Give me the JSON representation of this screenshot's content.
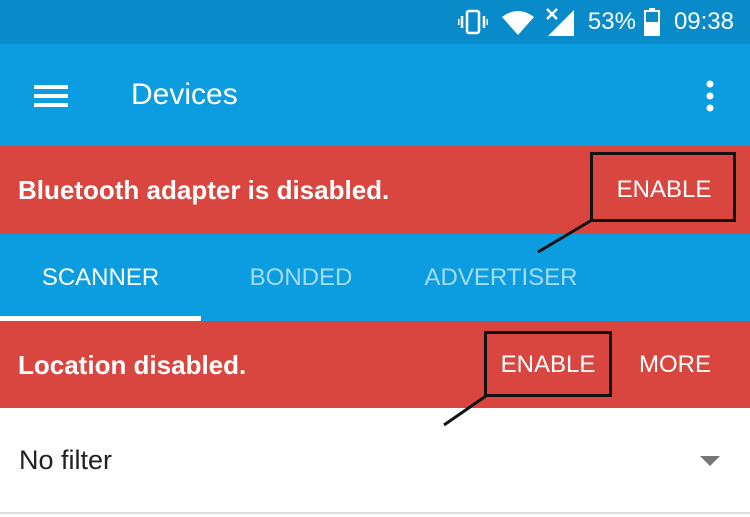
{
  "status_bar": {
    "battery": "53%",
    "time": "09:38",
    "icons": [
      "vibrate-icon",
      "wifi-icon",
      "cell-signal-no-service-icon",
      "battery-icon"
    ]
  },
  "app_bar": {
    "title": "Devices",
    "menu_icon": "hamburger-menu-icon",
    "overflow_icon": "more-vert-icon"
  },
  "bluetooth_banner": {
    "message": "Bluetooth adapter is disabled.",
    "enable_label": "ENABLE"
  },
  "tabs": [
    {
      "label": "SCANNER",
      "active": true
    },
    {
      "label": "BONDED",
      "active": false
    },
    {
      "label": "ADVERTISER",
      "active": false
    }
  ],
  "location_banner": {
    "message": "Location disabled.",
    "enable_label": "ENABLE",
    "more_label": "MORE"
  },
  "filter": {
    "value": "No filter"
  },
  "colors": {
    "status_bar": "#0a8bc9",
    "primary": "#0b9ddf",
    "warning": "#d9463f",
    "tab_inactive": "#a6dbf5",
    "text": "#222222"
  }
}
